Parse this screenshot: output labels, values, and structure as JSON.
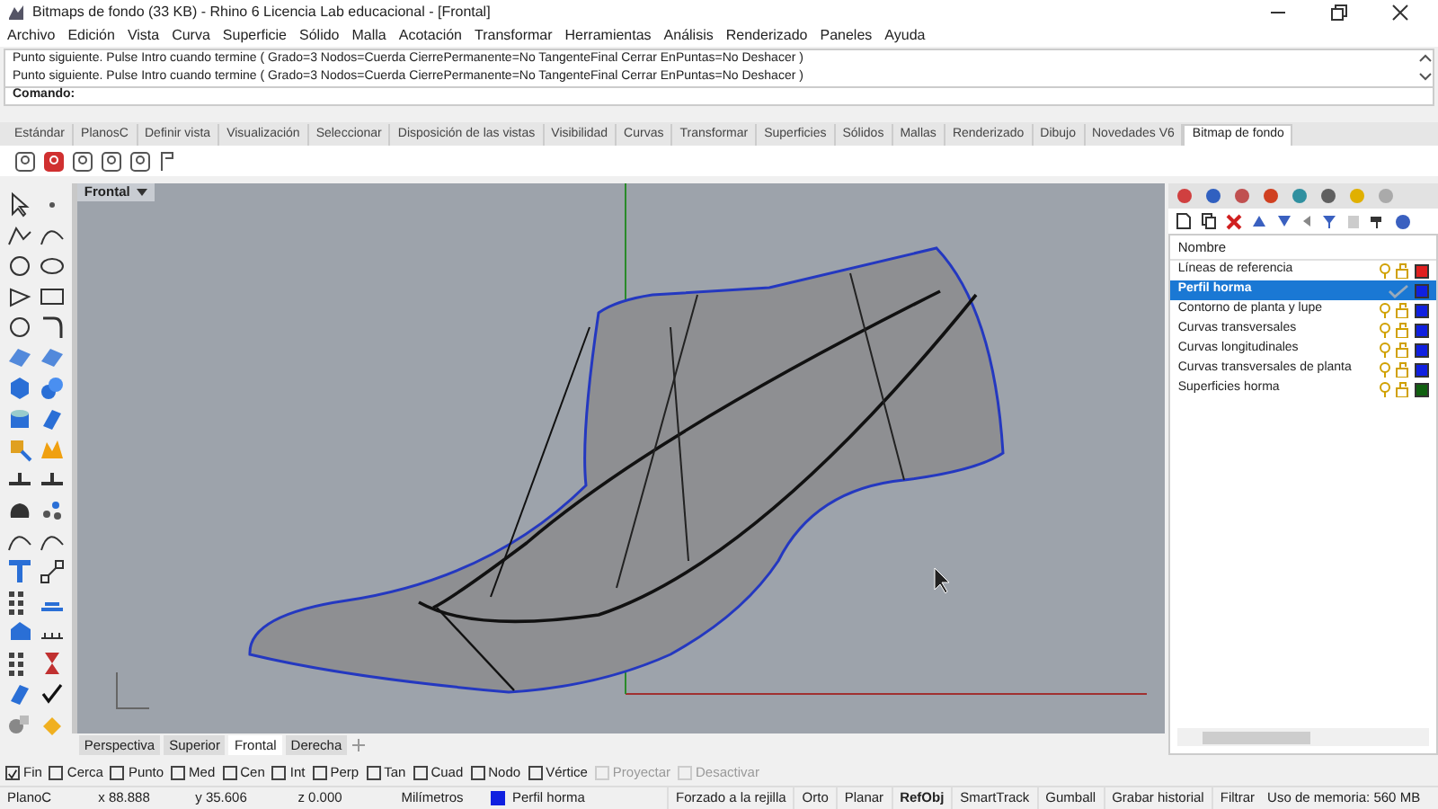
{
  "window": {
    "title": "Bitmaps de fondo (33 KB) - Rhino 6 Licencia Lab educacional - [Frontal]"
  },
  "menu": [
    "Archivo",
    "Edición",
    "Vista",
    "Curva",
    "Superficie",
    "Sólido",
    "Malla",
    "Acotación",
    "Transformar",
    "Herramientas",
    "Análisis",
    "Renderizado",
    "Paneles",
    "Ayuda"
  ],
  "command_history": [
    "Punto siguiente. Pulse Intro cuando termine ( Grado=3  Nodos=Cuerda  CierrePermanente=No  TangenteFinal  Cerrar  EnPuntas=No  Deshacer )",
    "Punto siguiente. Pulse Intro cuando termine ( Grado=3  Nodos=Cuerda  CierrePermanente=No  TangenteFinal  Cerrar  EnPuntas=No  Deshacer )"
  ],
  "command_prompt": "Comando:",
  "toolbar_tabs": [
    {
      "label": "Estándar",
      "selected": false
    },
    {
      "label": "PlanosC",
      "selected": false
    },
    {
      "label": "Definir vista",
      "selected": false
    },
    {
      "label": "Visualización",
      "selected": false
    },
    {
      "label": "Seleccionar",
      "selected": false
    },
    {
      "label": "Disposición de las vistas",
      "selected": false
    },
    {
      "label": "Visibilidad",
      "selected": false
    },
    {
      "label": "Curvas",
      "selected": false
    },
    {
      "label": "Transformar",
      "selected": false
    },
    {
      "label": "Superficies",
      "selected": false
    },
    {
      "label": "Sólidos",
      "selected": false
    },
    {
      "label": "Mallas",
      "selected": false
    },
    {
      "label": "Renderizado",
      "selected": false
    },
    {
      "label": "Dibujo",
      "selected": false
    },
    {
      "label": "Novedades V6",
      "selected": false
    },
    {
      "label": "Bitmap de fondo",
      "selected": true
    }
  ],
  "viewport": {
    "title": "Frontal"
  },
  "viewport_tabs": [
    {
      "label": "Perspectiva",
      "selected": false
    },
    {
      "label": "Superior",
      "selected": false
    },
    {
      "label": "Frontal",
      "selected": true
    },
    {
      "label": "Derecha",
      "selected": false
    }
  ],
  "layers": {
    "column": "Nombre",
    "items": [
      {
        "name": "Líneas de referencia",
        "selected": false,
        "current": false,
        "color": "#e02020"
      },
      {
        "name": "Perfil horma",
        "selected": true,
        "current": true,
        "color": "#1020e0"
      },
      {
        "name": "Contorno de planta y lupe",
        "selected": false,
        "current": false,
        "color": "#1020e0"
      },
      {
        "name": "Curvas transversales",
        "selected": false,
        "current": false,
        "color": "#1020e0"
      },
      {
        "name": "Curvas longitudinales",
        "selected": false,
        "current": false,
        "color": "#1020e0"
      },
      {
        "name": "Curvas transversales de planta",
        "selected": false,
        "current": false,
        "color": "#1020e0"
      },
      {
        "name": "Superficies horma",
        "selected": false,
        "current": false,
        "color": "#106010"
      }
    ]
  },
  "osnaps": [
    {
      "label": "Fin",
      "checked": true,
      "disabled": false
    },
    {
      "label": "Cerca",
      "checked": false,
      "disabled": false
    },
    {
      "label": "Punto",
      "checked": false,
      "disabled": false
    },
    {
      "label": "Med",
      "checked": false,
      "disabled": false
    },
    {
      "label": "Cen",
      "checked": false,
      "disabled": false
    },
    {
      "label": "Int",
      "checked": false,
      "disabled": false
    },
    {
      "label": "Perp",
      "checked": false,
      "disabled": false
    },
    {
      "label": "Tan",
      "checked": false,
      "disabled": false
    },
    {
      "label": "Cuad",
      "checked": false,
      "disabled": false
    },
    {
      "label": "Nodo",
      "checked": false,
      "disabled": false
    },
    {
      "label": "Vértice",
      "checked": false,
      "disabled": false
    },
    {
      "label": "Proyectar",
      "checked": false,
      "disabled": true
    },
    {
      "label": "Desactivar",
      "checked": false,
      "disabled": true
    }
  ],
  "status_bar": {
    "plane": "PlanoC",
    "x": "x 88.888",
    "y": "y 35.606",
    "z": "z 0.000",
    "units": "Milímetros",
    "layer": {
      "name": "Perfil horma",
      "color": "#1020e0"
    },
    "toggles": [
      {
        "label": "Forzado a la rejilla",
        "on": false
      },
      {
        "label": "Orto",
        "on": false
      },
      {
        "label": "Planar",
        "on": false
      },
      {
        "label": "RefObj",
        "on": true
      },
      {
        "label": "SmartTrack",
        "on": false
      },
      {
        "label": "Gumball",
        "on": false
      },
      {
        "label": "Grabar historial",
        "on": false
      },
      {
        "label": "Filtrar",
        "on": false
      }
    ],
    "memory": "Uso de memoria: 560 MB"
  }
}
